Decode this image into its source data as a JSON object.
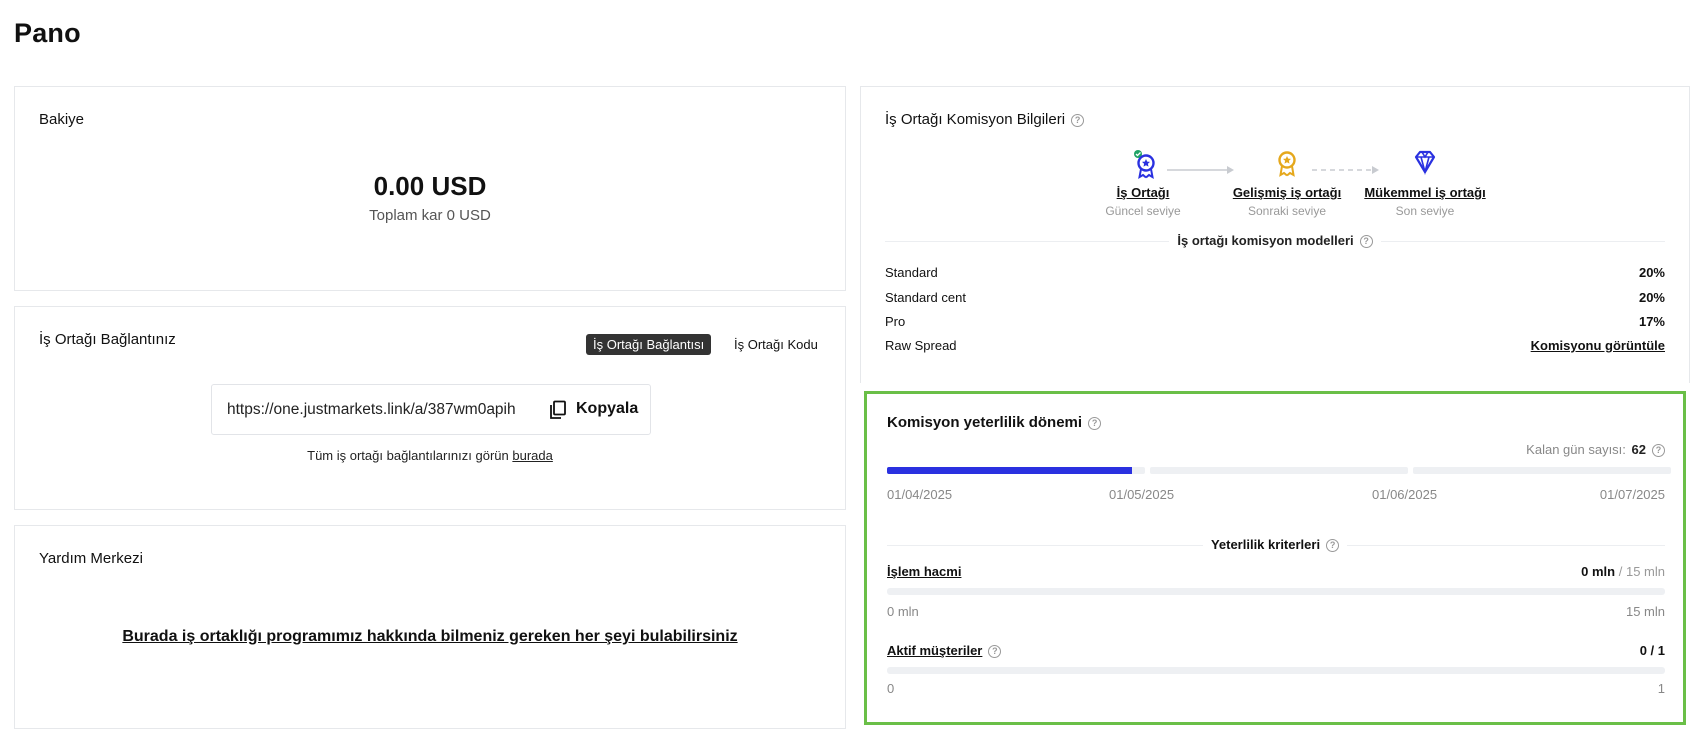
{
  "page": {
    "title": "Pano"
  },
  "balance": {
    "title": "Bakiye",
    "amount": "0.00 USD",
    "profit": "Toplam kar 0 USD"
  },
  "partner_link": {
    "title": "İş Ortağı Bağlantınız",
    "tabs": [
      "İş Ortağı Bağlantısı",
      "İş Ortağı Kodu"
    ],
    "active_tab": 0,
    "url": "https://one.justmarkets.link/a/387wm0apih",
    "copy_label": "Kopyala",
    "note_text": "Tüm iş ortağı bağlantılarınızı görün",
    "note_link": "burada"
  },
  "help": {
    "title": "Yardım Merkezi",
    "link_text": "Burada iş ortaklığı programımız hakkında bilmeniz gereken her şeyi bulabilirsiniz"
  },
  "commission": {
    "title": "İş Ortağı Komisyon Bilgileri",
    "levels": [
      {
        "name": "İş Ortağı",
        "status": "Güncel seviye",
        "icon": "medal-blue-icon",
        "color": "#2a31e0"
      },
      {
        "name": "Gelişmiş iş ortağı",
        "status": "Sonraki seviye",
        "icon": "medal-gold-icon",
        "color": "#e5a81c"
      },
      {
        "name": "Mükemmel iş ortağı",
        "status": "Son seviye",
        "icon": "diamond-icon",
        "color": "#2a31e0"
      }
    ],
    "models_title": "İş ortağı komisyon modelleri",
    "models": [
      {
        "name": "Standard",
        "value": "20%"
      },
      {
        "name": "Standard cent",
        "value": "20%"
      },
      {
        "name": "Pro",
        "value": "17%"
      },
      {
        "name": "Raw Spread",
        "value": "Komisyonu görüntüle"
      }
    ],
    "accent": "#2a31e0",
    "check_color": "#21a366"
  },
  "qualification": {
    "title": "Komisyon yeterlilik dönemi",
    "days_left_label": "Kalan gün sayısı:",
    "days_left_value": "62",
    "progress_fraction": 0.95,
    "dates": [
      "01/04/2025",
      "01/05/2025",
      "01/06/2025",
      "01/07/2025"
    ],
    "criteria_title": "Yeterlilik kriterleri",
    "criteria": [
      {
        "name": "İşlem hacmi",
        "current": "0 mln",
        "target": "/ 15 mln",
        "min": "0 mln",
        "max": "15 mln",
        "fraction": 0
      },
      {
        "name": "Aktif müşteriler",
        "current": "0 / 1",
        "target": "",
        "min": "0",
        "max": "1",
        "fraction": 0
      }
    ],
    "highlight_color": "#6abf47"
  }
}
